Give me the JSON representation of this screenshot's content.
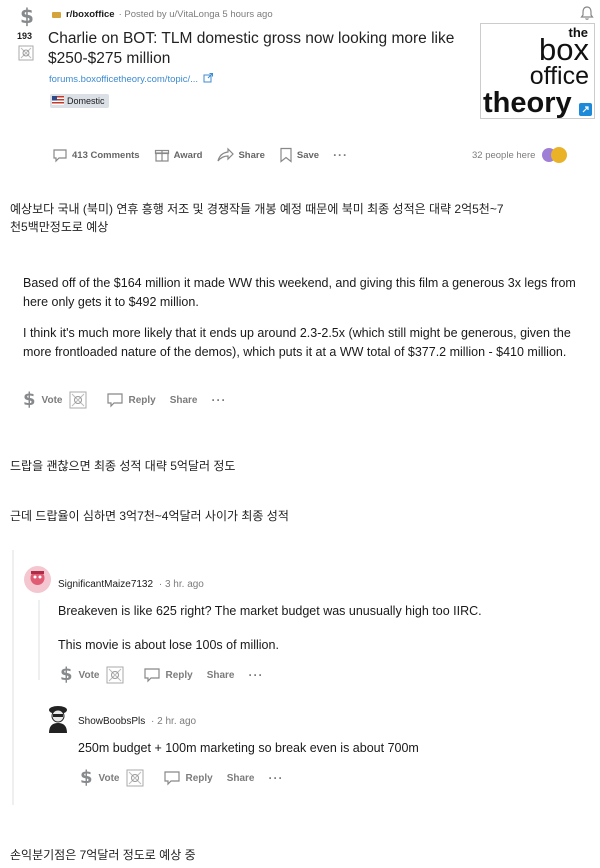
{
  "post": {
    "vote_count": "193",
    "subreddit": "r/boxoffice",
    "posted_by": "· Posted by u/VitaLonga 5 hours ago",
    "title": "Charlie on BOT: TLM domestic gross now looking more like $250-$275 million",
    "link": "forums.boxofficetheory.com/topic/...",
    "flair": "Domestic",
    "thumbnail_lines": [
      "the",
      "box",
      "office",
      "theory"
    ],
    "comments_label": "413 Comments",
    "award_label": "Award",
    "share_label": "Share",
    "save_label": "Save",
    "more_label": "···",
    "people_here": "32 people here"
  },
  "korean": {
    "line1": "예상보다 국내 (북미) 연휴 흥행 저조 및 경쟁작들 개봉 예정 때문에 북미 최종 성적은 대략 2억5천~7",
    "line2": "천5백만정도로 예상",
    "line3": "드랍을 괜찮으면 최종 성적 대략 5억달러 정도",
    "line4": "근데 드랍율이 심하면 3억7천~4억달러 사이가 최종 성적",
    "line5": "손익분기점은 7억달러 정도로 예상 중"
  },
  "comment1": {
    "p1": "Based off of the $164 million it made WW this weekend, and giving this film a generous 3x legs from here only gets it to $492 million.",
    "p2": "I think it's much more likely that it ends up around 2.3-2.5x (which still might be generous, given the more frontloaded nature of the demos), which puts it at a WW total of $377.2 million - $410 million.",
    "vote": "Vote",
    "reply": "Reply",
    "share": "Share",
    "more": "···"
  },
  "comment2": {
    "user": "SignificantMaize7132",
    "time": "· 3 hr. ago",
    "p1": "Breakeven is like 625 right? The market budget was unusually high too IIRC.",
    "p2": "This movie is about lose 100s of million.",
    "vote": "Vote",
    "reply": "Reply",
    "share": "Share",
    "more": "···"
  },
  "comment3": {
    "user": "ShowBoobsPls",
    "time": "· 2 hr. ago",
    "p1": "250m budget + 100m marketing so break even is about 700m",
    "vote": "Vote",
    "reply": "Reply",
    "share": "Share",
    "more": "···"
  },
  "colors": {
    "flair_bg": "#dae0e6",
    "link": "#0079d3",
    "muted": "#7c7c7c",
    "thread_line": "#edeff1"
  },
  "icons": [
    "dollar-icon",
    "comment-icon",
    "award-icon",
    "share-icon",
    "save-icon",
    "bell-icon",
    "external-link-icon",
    "flag-icon"
  ]
}
